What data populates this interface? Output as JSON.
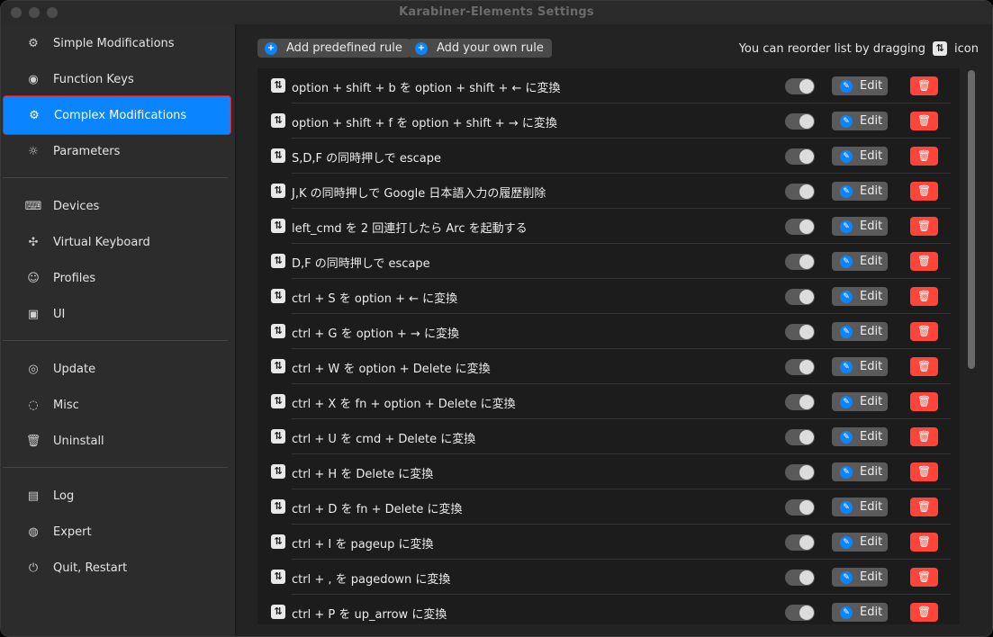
{
  "window": {
    "title": "Karabiner-Elements Settings"
  },
  "sidebar": {
    "groups": [
      [
        {
          "label": "Simple Modifications",
          "icon": "⚙",
          "name": "gear-icon"
        },
        {
          "label": "Function Keys",
          "icon": "◉",
          "name": "speaker-icon"
        },
        {
          "label": "Complex Modifications",
          "icon": "⚙",
          "name": "gears-icon",
          "active": true
        },
        {
          "label": "Parameters",
          "icon": "☼",
          "name": "sun-icon"
        }
      ],
      [
        {
          "label": "Devices",
          "icon": "⌨",
          "name": "keyboard-icon"
        },
        {
          "label": "Virtual Keyboard",
          "icon": "✣",
          "name": "puzzle-icon"
        },
        {
          "label": "Profiles",
          "icon": "☺",
          "name": "people-icon"
        },
        {
          "label": "UI",
          "icon": "▣",
          "name": "toggles-icon"
        }
      ],
      [
        {
          "label": "Update",
          "icon": "◎",
          "name": "globe-icon"
        },
        {
          "label": "Misc",
          "icon": "◌",
          "name": "leaf-icon"
        },
        {
          "label": "Uninstall",
          "icon": "🗑",
          "name": "trash-icon"
        }
      ],
      [
        {
          "label": "Log",
          "icon": "▤",
          "name": "document-icon"
        },
        {
          "label": "Expert",
          "icon": "◍",
          "name": "flame-icon"
        },
        {
          "label": "Quit, Restart",
          "icon": "⏻",
          "name": "power-icon"
        }
      ]
    ]
  },
  "toolbar": {
    "add_predefined_label": "Add predefined rule",
    "add_own_label": "Add your own rule",
    "hint_before": "You can reorder list by dragging",
    "hint_after": "icon",
    "drag_glyph": "⇅"
  },
  "rules": [
    {
      "description": "option + shift + b を option + shift + ← に変換"
    },
    {
      "description": "option + shift + f を option + shift + → に変換"
    },
    {
      "description": "S,D,F の同時押しで escape"
    },
    {
      "description": "J,K の同時押しで Google 日本語入力の履歴削除"
    },
    {
      "description": "left_cmd を 2 回連打したら Arc を起動する"
    },
    {
      "description": "D,F の同時押しで escape"
    },
    {
      "description": "ctrl + S を option + ← に変換"
    },
    {
      "description": "ctrl + G を option + → に変換"
    },
    {
      "description": "ctrl + W を option + Delete に変換"
    },
    {
      "description": "ctrl + X を fn + option + Delete に変換"
    },
    {
      "description": "ctrl + U を cmd + Delete に変換"
    },
    {
      "description": "ctrl + H を Delete に変換"
    },
    {
      "description": "ctrl + D を fn + Delete に変換"
    },
    {
      "description": "ctrl + I を pageup に変換"
    },
    {
      "description": "ctrl + , を pagedown に変換"
    },
    {
      "description": "ctrl + P を up_arrow に変換"
    }
  ],
  "rule_controls": {
    "edit_label": "Edit",
    "delete_glyph": "🗑"
  },
  "colors": {
    "accent": "#0b84ff",
    "delete": "#ff453a",
    "background": "#1f1f1f"
  }
}
